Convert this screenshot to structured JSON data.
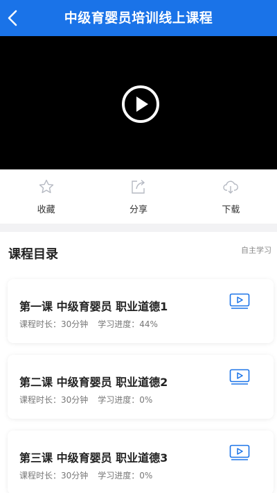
{
  "header": {
    "title": "中级育婴员培训线上课程",
    "accent": "#1a73e8"
  },
  "video": {
    "play_icon": "play-circle-icon"
  },
  "actions": [
    {
      "label": "收藏",
      "icon": "star-icon"
    },
    {
      "label": "分享",
      "icon": "share-icon"
    },
    {
      "label": "下载",
      "icon": "cloud-download-icon"
    }
  ],
  "catalog": {
    "title": "课程目录",
    "link": "自主学习",
    "lessons": [
      {
        "title": "第一课 中级育婴员 职业道德1",
        "duration": "课程时长：30分钟",
        "progress": "学习进度：44%",
        "icon": "video-icon"
      },
      {
        "title": "第二课 中级育婴员 职业道德2",
        "duration": "课程时长：30分钟",
        "progress": "学习进度：0%",
        "icon": "video-icon"
      },
      {
        "title": "第三课 中级育婴员 职业道德3",
        "duration": "课程时长：30分钟",
        "progress": "学习进度：0%",
        "icon": "video-icon"
      }
    ]
  }
}
